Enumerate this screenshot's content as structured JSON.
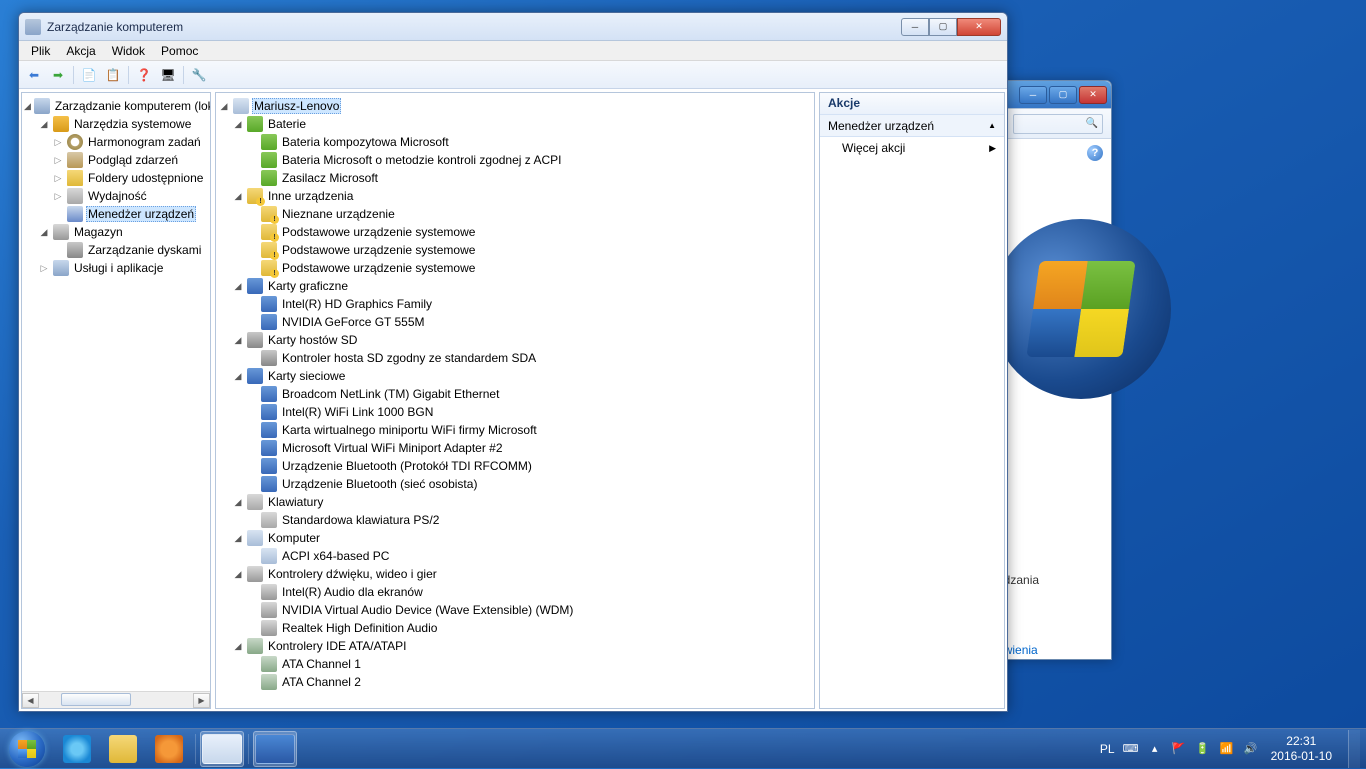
{
  "window": {
    "title": "Zarządzanie komputerem",
    "menu": [
      "Plik",
      "Akcja",
      "Widok",
      "Pomoc"
    ]
  },
  "left_tree": {
    "root": "Zarządzanie komputerem (lokalny)",
    "tools": "Narzędzia systemowe",
    "scheduler": "Harmonogram zadań",
    "event": "Podgląd zdarzeń",
    "shared": "Foldery udostępnione",
    "perf": "Wydajność",
    "devmgr": "Menedżer urządzeń",
    "storage": "Magazyn",
    "diskmgr": "Zarządzanie dyskami",
    "services": "Usługi i aplikacje"
  },
  "device_tree": {
    "root": "Mariusz-Lenovo",
    "batteries": {
      "label": "Baterie",
      "items": [
        "Bateria kompozytowa Microsoft",
        "Bateria Microsoft o metodzie kontroli zgodnej z ACPI",
        "Zasilacz Microsoft"
      ]
    },
    "other": {
      "label": "Inne urządzenia",
      "items": [
        "Nieznane urządzenie",
        "Podstawowe urządzenie systemowe",
        "Podstawowe urządzenie systemowe",
        "Podstawowe urządzenie systemowe"
      ]
    },
    "gpu": {
      "label": "Karty graficzne",
      "items": [
        "Intel(R) HD Graphics Family",
        "NVIDIA GeForce GT 555M"
      ]
    },
    "sd": {
      "label": "Karty hostów SD",
      "items": [
        "Kontroler hosta SD zgodny ze standardem SDA"
      ]
    },
    "net": {
      "label": "Karty sieciowe",
      "items": [
        "Broadcom NetLink (TM) Gigabit Ethernet",
        "Intel(R) WiFi Link 1000 BGN",
        "Karta wirtualnego miniportu WiFi firmy Microsoft",
        "Microsoft Virtual WiFi Miniport Adapter #2",
        "Urządzenie Bluetooth (Protokół TDI RFCOMM)",
        "Urządzenie Bluetooth (sieć osobista)"
      ]
    },
    "keyboard": {
      "label": "Klawiatury",
      "items": [
        "Standardowa klawiatura PS/2"
      ]
    },
    "computer": {
      "label": "Komputer",
      "items": [
        "ACPI x64-based PC"
      ]
    },
    "audio": {
      "label": "Kontrolery dźwięku, wideo i gier",
      "items": [
        "Intel(R) Audio dla ekranów",
        "NVIDIA Virtual Audio Device (Wave Extensible) (WDM)",
        "Realtek High Definition Audio"
      ]
    },
    "ide": {
      "label": "Kontrolery IDE ATA/ATAPI",
      "items": [
        "ATA Channel 1",
        "ATA Channel 2"
      ]
    }
  },
  "actions": {
    "header": "Akcje",
    "section": "Menedżer urządzeń",
    "more": "Więcej akcji"
  },
  "bg_window": {
    "text1": "prowadzania",
    "link": "ń ustawienia"
  },
  "taskbar": {
    "lang": "PL",
    "time": "22:31",
    "date": "2016-01-10"
  }
}
